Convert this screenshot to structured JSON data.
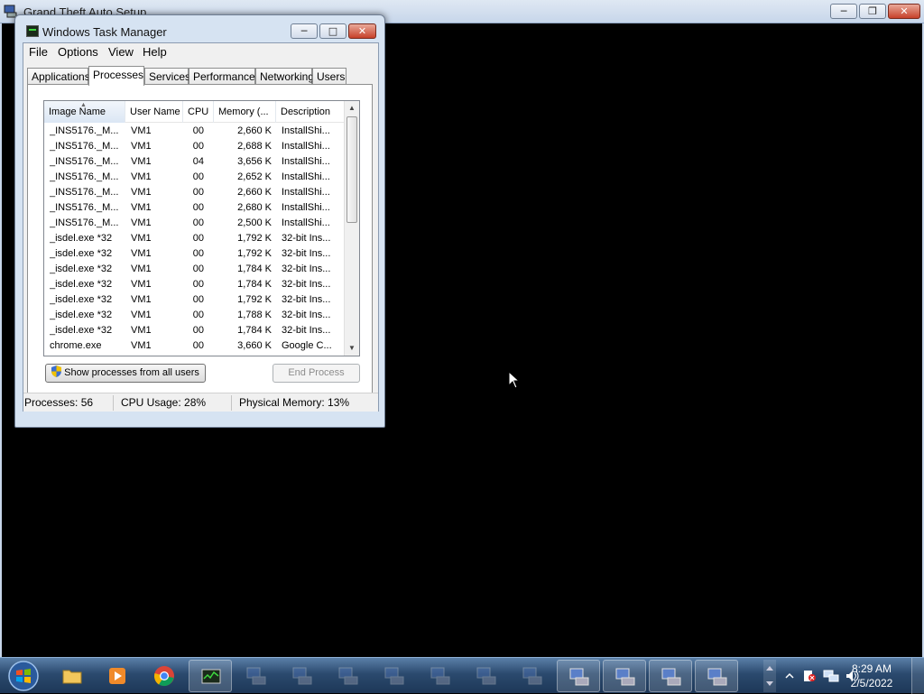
{
  "background_window": {
    "title": "Grand Theft Auto Setup"
  },
  "task_manager": {
    "title": "Windows Task Manager",
    "menu": [
      "File",
      "Options",
      "View",
      "Help"
    ],
    "tabs": [
      {
        "label": "Applications",
        "active": false
      },
      {
        "label": "Processes",
        "active": true
      },
      {
        "label": "Services",
        "active": false
      },
      {
        "label": "Performance",
        "active": false
      },
      {
        "label": "Networking",
        "active": false
      },
      {
        "label": "Users",
        "active": false
      }
    ],
    "columns": {
      "name": "Image Name",
      "user": "User Name",
      "cpu": "CPU",
      "memory": "Memory (...",
      "description": "Description"
    },
    "rows": [
      {
        "name": "_INS5176._M...",
        "user": "VM1",
        "cpu": "00",
        "memory": "2,660 K",
        "description": "InstallShi..."
      },
      {
        "name": "_INS5176._M...",
        "user": "VM1",
        "cpu": "00",
        "memory": "2,688 K",
        "description": "InstallShi..."
      },
      {
        "name": "_INS5176._M...",
        "user": "VM1",
        "cpu": "04",
        "memory": "3,656 K",
        "description": "InstallShi..."
      },
      {
        "name": "_INS5176._M...",
        "user": "VM1",
        "cpu": "00",
        "memory": "2,652 K",
        "description": "InstallShi..."
      },
      {
        "name": "_INS5176._M...",
        "user": "VM1",
        "cpu": "00",
        "memory": "2,660 K",
        "description": "InstallShi..."
      },
      {
        "name": "_INS5176._M...",
        "user": "VM1",
        "cpu": "00",
        "memory": "2,680 K",
        "description": "InstallShi..."
      },
      {
        "name": "_INS5176._M...",
        "user": "VM1",
        "cpu": "00",
        "memory": "2,500 K",
        "description": "InstallShi..."
      },
      {
        "name": "_isdel.exe *32",
        "user": "VM1",
        "cpu": "00",
        "memory": "1,792 K",
        "description": "32-bit Ins..."
      },
      {
        "name": "_isdel.exe *32",
        "user": "VM1",
        "cpu": "00",
        "memory": "1,792 K",
        "description": "32-bit Ins..."
      },
      {
        "name": "_isdel.exe *32",
        "user": "VM1",
        "cpu": "00",
        "memory": "1,784 K",
        "description": "32-bit Ins..."
      },
      {
        "name": "_isdel.exe *32",
        "user": "VM1",
        "cpu": "00",
        "memory": "1,784 K",
        "description": "32-bit Ins..."
      },
      {
        "name": "_isdel.exe *32",
        "user": "VM1",
        "cpu": "00",
        "memory": "1,792 K",
        "description": "32-bit Ins..."
      },
      {
        "name": "_isdel.exe *32",
        "user": "VM1",
        "cpu": "00",
        "memory": "1,788 K",
        "description": "32-bit Ins..."
      },
      {
        "name": "_isdel.exe *32",
        "user": "VM1",
        "cpu": "00",
        "memory": "1,784 K",
        "description": "32-bit Ins..."
      },
      {
        "name": "chrome.exe",
        "user": "VM1",
        "cpu": "00",
        "memory": "3,660 K",
        "description": "Google C..."
      }
    ],
    "buttons": {
      "show_all": "Show processes from all users",
      "end_process": "End Process"
    },
    "status": {
      "processes": "Processes: 56",
      "cpu": "CPU Usage: 28%",
      "memory": "Physical Memory: 13%"
    }
  },
  "taskbar": {
    "time": "8:29 AM",
    "date": "2/5/2022"
  },
  "icons": {
    "start": "windows-start-orb",
    "explorer": "folder-icon",
    "media": "media-player-icon",
    "chrome": "chrome-icon",
    "taskmgr": "task-manager-icon",
    "setup": "setup-computer-icon"
  },
  "colors": {
    "desktop": "#000000",
    "window_frame": "#d6e3f2",
    "taskbar": "#2b4a6e",
    "close_button": "#c7402a"
  }
}
